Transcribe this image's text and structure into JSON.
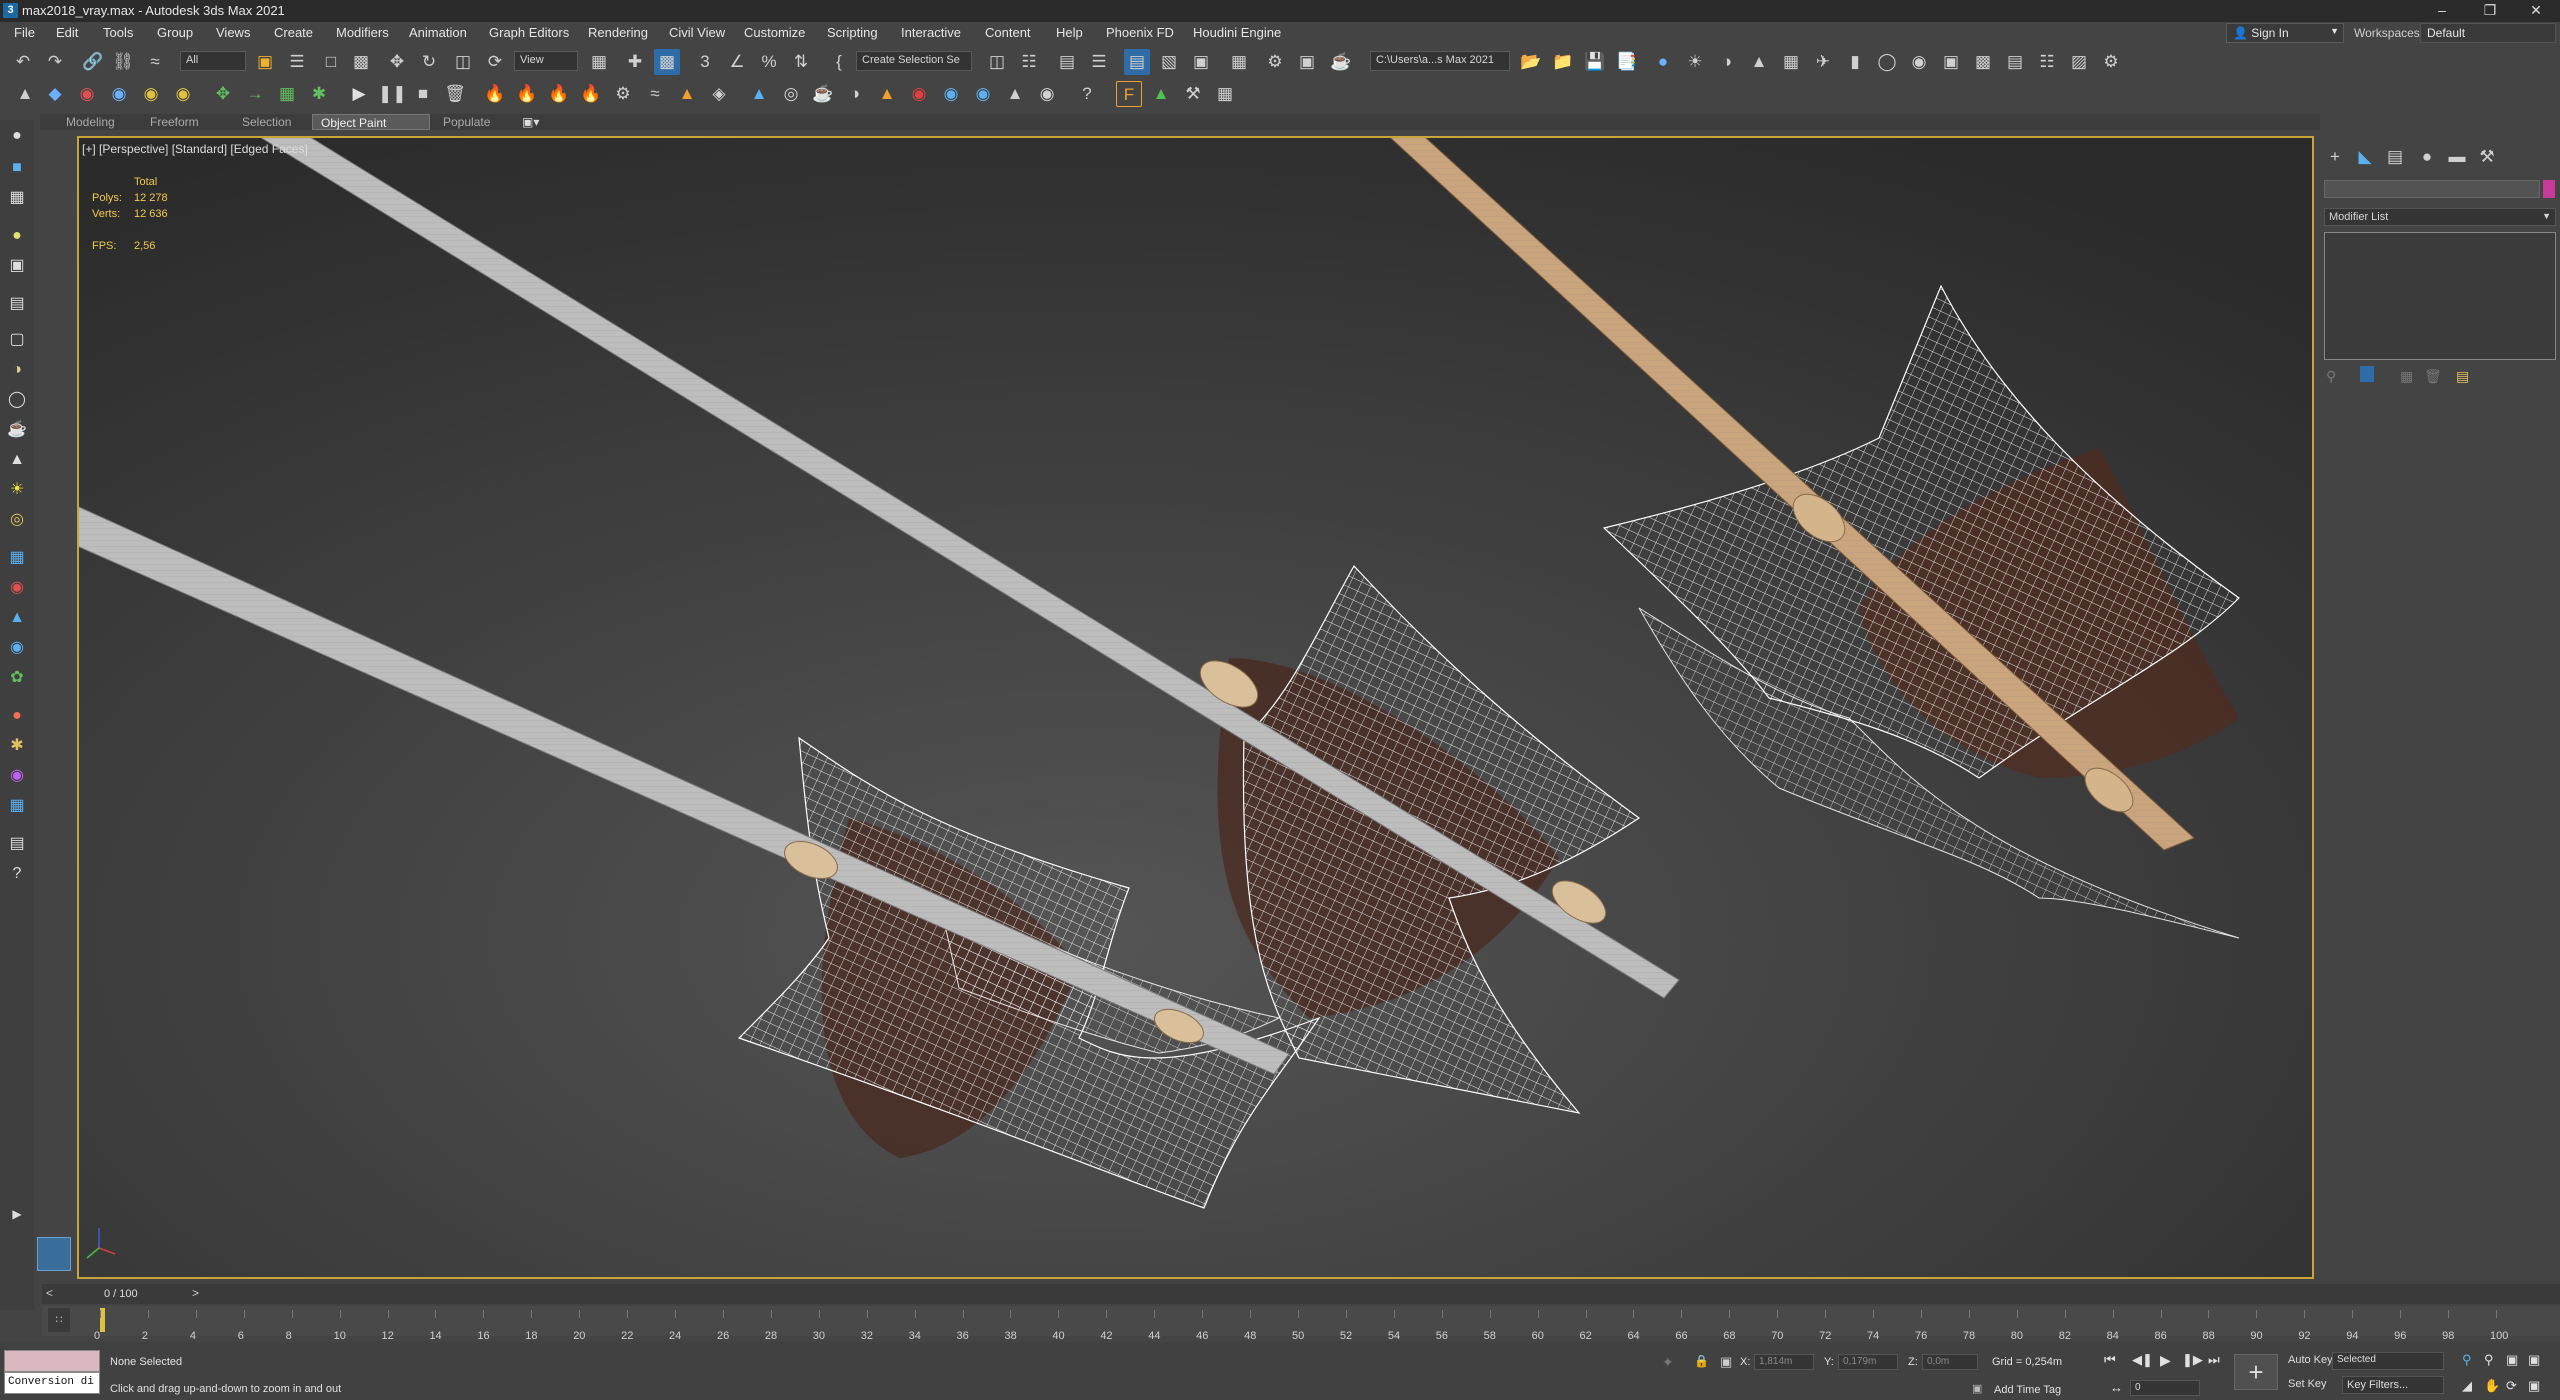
{
  "window": {
    "title": "max2018_vray.max - Autodesk 3ds Max 2021"
  },
  "menu": [
    "File",
    "Edit",
    "Tools",
    "Group",
    "Views",
    "Create",
    "Modifiers",
    "Animation",
    "Graph Editors",
    "Rendering",
    "Civil View",
    "Customize",
    "Scripting",
    "Interactive",
    "Content",
    "Help",
    "Phoenix FD",
    "Houdini Engine"
  ],
  "account": {
    "sign_in": "Sign In",
    "workspaces_label": "Workspaces:",
    "workspace": "Default"
  },
  "toolbar": {
    "selection_filter": "All",
    "ref_coord": "View",
    "selection_set": "Create Selection Se",
    "project_path": "C:\\Users\\a...s Max 2021"
  },
  "ribbon_tabs": [
    "Modeling",
    "Freeform",
    "Selection",
    "Object Paint",
    "Populate"
  ],
  "ribbon_active": "Object Paint",
  "viewport": {
    "label": "[+] [Perspective] [Standard] [Edged Faces]",
    "stats_header": "Total",
    "polys_label": "Polys:",
    "polys": "12 278",
    "verts_label": "Verts:",
    "verts": "12 636",
    "fps_label": "FPS:",
    "fps": "2,56"
  },
  "command_panel": {
    "modifier_list": "Modifier List"
  },
  "timeline": {
    "frame": "0 / 100",
    "prev": "<",
    "next": ">",
    "ticks": [
      "0",
      "2",
      "4",
      "6",
      "8",
      "10",
      "12",
      "14",
      "16",
      "18",
      "20",
      "22",
      "24",
      "26",
      "28",
      "30",
      "32",
      "34",
      "36",
      "38",
      "40",
      "42",
      "44",
      "46",
      "48",
      "50",
      "52",
      "54",
      "56",
      "58",
      "60",
      "62",
      "64",
      "66",
      "68",
      "70",
      "72",
      "74",
      "76",
      "78",
      "80",
      "82",
      "84",
      "86",
      "88",
      "90",
      "92",
      "94",
      "96",
      "98",
      "100"
    ]
  },
  "status": {
    "maxscript_input": "Conversion di",
    "selection": "None Selected",
    "prompt": "Click and drag up-and-down to zoom in and out",
    "x_label": "X:",
    "x_value": "1,814m",
    "y_label": "Y:",
    "y_value": "0,179m",
    "z_label": "Z:",
    "z_value": "0,0m",
    "grid": "Grid = 0,254m",
    "add_time_tag": "Add Time Tag",
    "auto_key": "Auto Key",
    "set_key": "Set Key",
    "key_mode": "Selected",
    "key_filters": "Key Filters...",
    "current_frame": "0"
  }
}
